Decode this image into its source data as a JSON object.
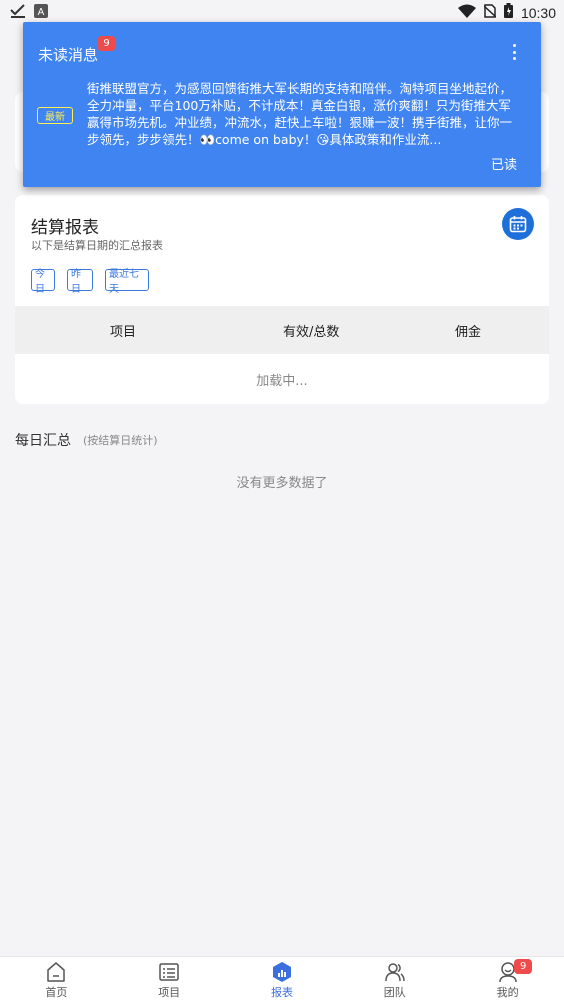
{
  "status_bar": {
    "time": "10:30",
    "left_icons": [
      "check-icon",
      "app-a-icon"
    ],
    "right_icons": [
      "wifi-icon",
      "no-sim-icon",
      "battery-icon"
    ]
  },
  "popup": {
    "title": "未读消息",
    "badge_count": "9",
    "new_tag": "最新",
    "message": "街推联盟官方，为感恩回馈街推大军长期的支持和陪伴。淘特项目坐地起价，全力冲量，平台100万补贴，不计成本！真金白银，涨价爽翻！只为街推大军赢得市场先机。冲业绩，冲流水，赶快上车啦！狠赚一波！携手街推，让你一步领先，步步领先！👀come on baby！😘具体政策和作业流...",
    "read_label": "已读",
    "bg_color": "#3f84f0"
  },
  "settlement": {
    "title": "结算报表",
    "subtitle": "以下是结算日期的汇总报表",
    "chips": [
      "今日",
      "昨日",
      "最近七天"
    ],
    "columns": [
      "项目",
      "有效/总数",
      "佣金"
    ],
    "loading": "加载中..."
  },
  "daily": {
    "title": "每日汇总",
    "subtitle": "(按结算日统计)",
    "empty": "没有更多数据了"
  },
  "nav": {
    "items": [
      {
        "label": "首页",
        "icon": "home-icon"
      },
      {
        "label": "项目",
        "icon": "list-icon"
      },
      {
        "label": "报表",
        "icon": "report-icon"
      },
      {
        "label": "团队",
        "icon": "team-icon"
      },
      {
        "label": "我的",
        "icon": "profile-icon"
      }
    ],
    "active_index": 2,
    "profile_badge": "9",
    "active_color": "#3b6fe0"
  }
}
